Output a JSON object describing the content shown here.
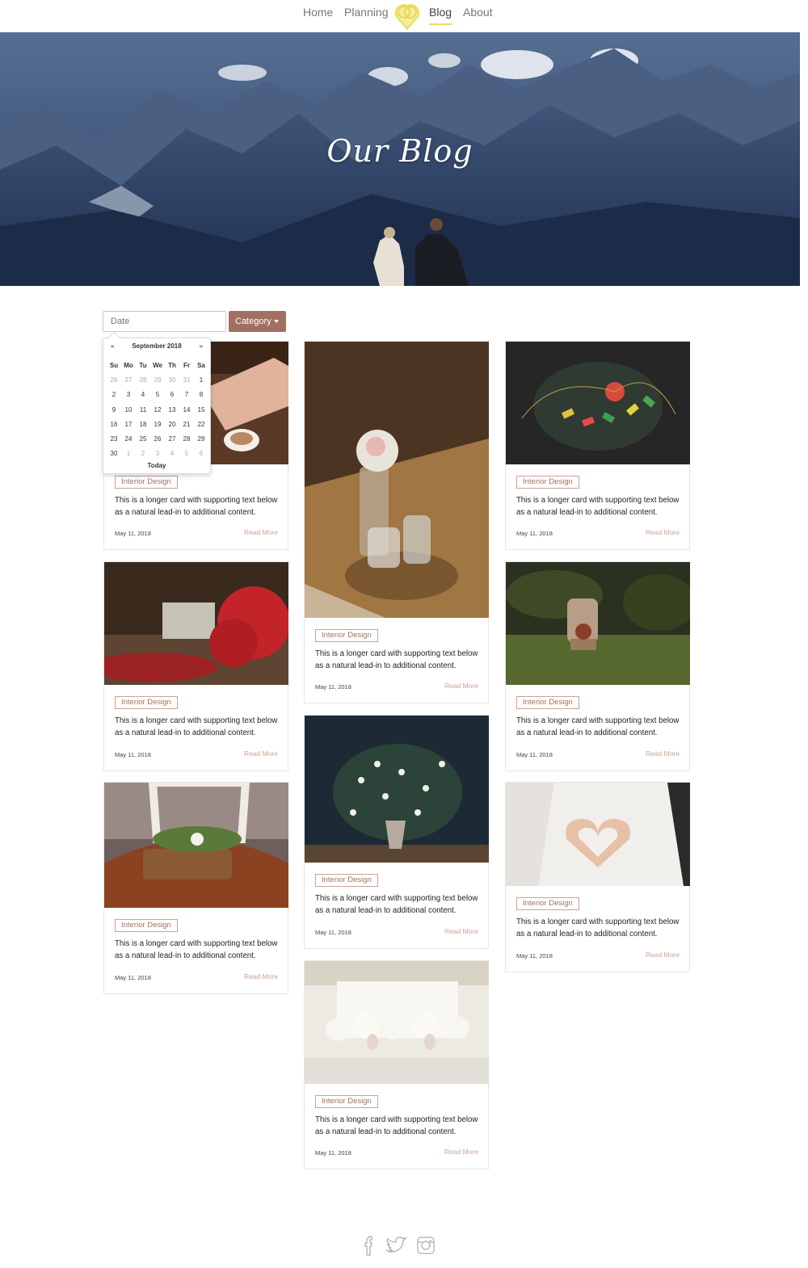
{
  "nav": {
    "home": "Home",
    "planning": "Planning",
    "blog": "Blog",
    "about": "About",
    "active": "Blog"
  },
  "hero": {
    "title": "Our Blog"
  },
  "filters": {
    "date_placeholder": "Date",
    "category_label": "Category"
  },
  "datepicker": {
    "prev": "«",
    "next": "»",
    "month_label": "September 2018",
    "weekdays": [
      "Su",
      "Mo",
      "Tu",
      "We",
      "Th",
      "Fr",
      "Sa"
    ],
    "weeks": [
      [
        "26",
        "27",
        "28",
        "29",
        "30",
        "31",
        "1"
      ],
      [
        "2",
        "3",
        "4",
        "5",
        "6",
        "7",
        "8"
      ],
      [
        "9",
        "10",
        "11",
        "12",
        "13",
        "14",
        "15"
      ],
      [
        "16",
        "17",
        "18",
        "19",
        "20",
        "21",
        "22"
      ],
      [
        "23",
        "24",
        "25",
        "26",
        "27",
        "28",
        "29"
      ],
      [
        "30",
        "1",
        "2",
        "3",
        "4",
        "5",
        "6"
      ]
    ],
    "today_label": "Today"
  },
  "cards": [
    {
      "tag": "Interior Design",
      "text": "This is a longer card with supporting text below as a natural lead-in to additional content.",
      "date": "May 11, 2018",
      "read_more": "Read More"
    },
    {
      "tag": "Interior Design",
      "text": "This is a longer card with supporting text below as a natural lead-in to additional content.",
      "date": "May 11, 2018",
      "read_more": "Read More"
    },
    {
      "tag": "Interior Design",
      "text": "This is a longer card with supporting text below as a natural lead-in to additional content.",
      "date": "May 11, 2018",
      "read_more": "Read More"
    },
    {
      "tag": "Interior Design",
      "text": "This is a longer card with supporting text below as a natural lead-in to additional content.",
      "date": "May 11, 2018",
      "read_more": "Read More"
    },
    {
      "tag": "Interior Design",
      "text": "This is a longer card with supporting text below as a natural lead-in to additional content.",
      "date": "May 11, 2018",
      "read_more": "Read More"
    },
    {
      "tag": "Interior Design",
      "text": "This is a longer card with supporting text below as a natural lead-in to additional content.",
      "date": "May 11, 2018",
      "read_more": "Read More"
    },
    {
      "tag": "Interior Design",
      "text": "This is a longer card with supporting text below as a natural lead-in to additional content.",
      "date": "May 11, 2018",
      "read_more": "Read More"
    },
    {
      "tag": "Interior Design",
      "text": "This is a longer card with supporting text below as a natural lead-in to additional content.",
      "date": "May 11, 2018",
      "read_more": "Read More"
    },
    {
      "tag": "Interior Design",
      "text": "This is a longer card with supporting text below as a natural lead-in to additional content.",
      "date": "May 11, 2018",
      "read_more": "Read More"
    },
    {
      "tag": "Interior Design",
      "text": "This is a longer card with supporting text below as a natural lead-in to additional content.",
      "date": "May 11, 2018",
      "read_more": "Read More"
    }
  ],
  "footer": {
    "icons": [
      "facebook-icon",
      "twitter-icon",
      "instagram-icon"
    ]
  },
  "colors": {
    "accent": "#a27060",
    "tag_border": "#c9a393",
    "nav_underline": "#e8dc6a",
    "logo": "#e8d84a"
  }
}
